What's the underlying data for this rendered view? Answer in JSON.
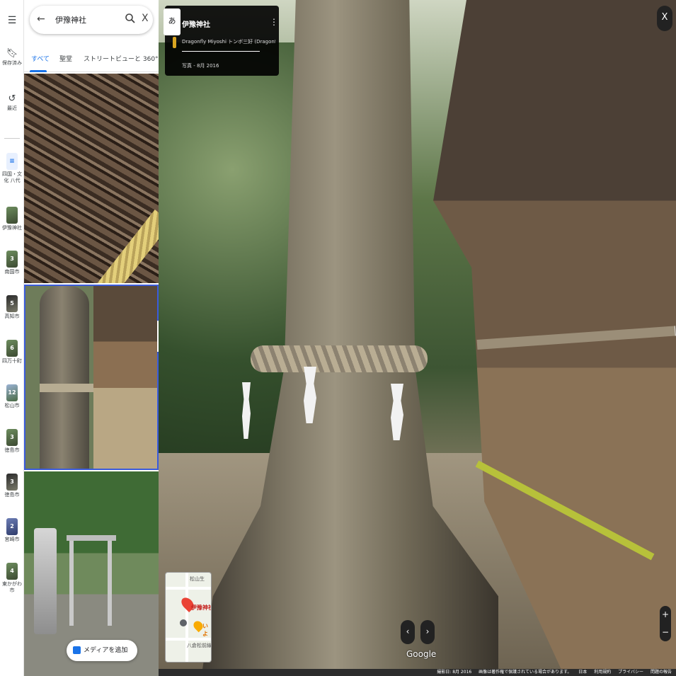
{
  "rail": {
    "menu_icon": "menu-icon",
    "saved_label": "保存済み",
    "recent_label": "最近",
    "recents": [
      {
        "name": "四国・文化 八代",
        "badge": "≡",
        "style": "list"
      },
      {
        "name": "伊豫神社",
        "badge": "",
        "style": "photo"
      },
      {
        "name": "南国市",
        "badge": "3",
        "style": "photo"
      },
      {
        "name": "高知市",
        "badge": "5",
        "style": "dark"
      },
      {
        "name": "四万十町",
        "badge": "6",
        "style": "photo"
      },
      {
        "name": "松山市",
        "badge": "12",
        "style": "sky"
      },
      {
        "name": "徳島市",
        "badge": "3",
        "style": "photo"
      },
      {
        "name": "徳島市",
        "badge": "3",
        "style": "dark"
      },
      {
        "name": "宮崎市",
        "badge": "2",
        "style": "blue"
      },
      {
        "name": "東かがわ市",
        "badge": "4",
        "style": "photo"
      }
    ]
  },
  "panel": {
    "search_query": "伊豫神社",
    "tabs": [
      "すべて",
      "聖堂",
      "ストリートビューと 360° ビュー"
    ],
    "add_media_label": "メディアを追加"
  },
  "street_view": {
    "ja_button": "あ",
    "place_title": "伊豫神社",
    "contributor": "Dragonfly Miyoshi トンボ三好 (Dragonfl_",
    "photo_date": "写真 - 8月 2016",
    "close_label": "X",
    "minimap": {
      "road_label": "松山生",
      "place_name": "伊豫神社",
      "yellow_label": "いよ",
      "school_label": "八倉松前線"
    },
    "brand": "Google",
    "zoom_in": "+",
    "zoom_out": "−",
    "prev_label": "‹",
    "next_label": "›"
  },
  "footer": {
    "capture_date": "撮影日: 8月 2016",
    "notice": "画像は著作権で保護されている場合があります。",
    "country": "日本",
    "terms": "利用規約",
    "privacy": "プライバシー",
    "report": "問題の報告"
  }
}
